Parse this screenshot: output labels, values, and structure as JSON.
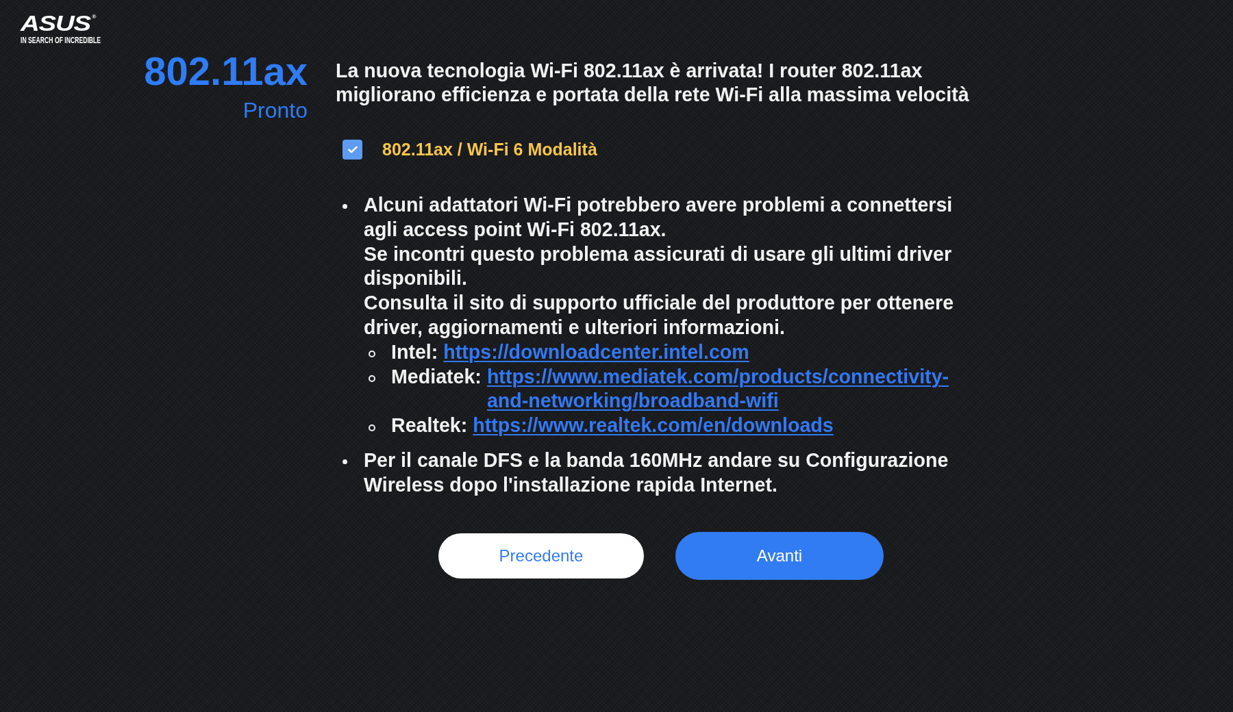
{
  "logo": {
    "wordmark": "ASUS$^{®}$",
    "tagline": "IN SEARCH OF INCREDIBLE"
  },
  "heading": {
    "title": "802.11ax",
    "subtitle": "Pronto"
  },
  "description": "La nuova tecnologia Wi-Fi 802.11ax è arrivata! I router 802.11ax migliorano efficienza e portata della rete Wi-Fi alla massima velocità",
  "mode_checkbox": {
    "label": "802.11ax / Wi-Fi 6 Modalità",
    "checked": true
  },
  "notes": [
    {
      "paragraphs": [
        "Alcuni adattatori Wi-Fi potrebbero avere problemi a connettersi agli access point Wi-Fi 802.11ax.",
        "Se incontri questo problema assicurati di usare gli ultimi driver disponibili.",
        "Consulta il sito di supporto ufficiale del produttore per ottenere driver, aggiornamenti e ulteriori informazioni."
      ],
      "links": [
        {
          "vendor": "Intel:",
          "url": "https://downloadcenter.intel.com"
        },
        {
          "vendor": "Mediatek:",
          "url": "https://www.mediatek.com/products/connectivity-and-networking/broadband-wifi"
        },
        {
          "vendor": "Realtek:",
          "url": "https://www.realtek.com/en/downloads"
        }
      ]
    },
    {
      "paragraphs": [
        "Per il canale DFS e la banda 160MHz andare su Configurazione Wireless dopo l'installazione rapida Internet."
      ]
    }
  ],
  "buttons": [
    {
      "label": "Precedente",
      "kind": "secondary"
    },
    {
      "label": "Avanti",
      "kind": "primary"
    }
  ]
}
